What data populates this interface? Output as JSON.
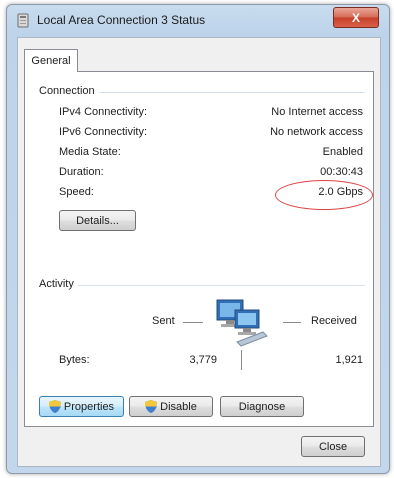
{
  "window": {
    "title": "Local Area Connection 3 Status",
    "close_glyph": "X"
  },
  "tabs": [
    {
      "label": "General"
    }
  ],
  "connection": {
    "heading": "Connection",
    "rows": [
      {
        "label": "IPv4 Connectivity:",
        "value": "No Internet access"
      },
      {
        "label": "IPv6 Connectivity:",
        "value": "No network access"
      },
      {
        "label": "Media State:",
        "value": "Enabled"
      },
      {
        "label": "Duration:",
        "value": "00:30:43"
      },
      {
        "label": "Speed:",
        "value": "2.0 Gbps"
      }
    ],
    "details_button": "Details..."
  },
  "activity": {
    "heading": "Activity",
    "sent_label": "Sent",
    "received_label": "Received",
    "bytes_label": "Bytes:",
    "bytes_sent": "3,779",
    "bytes_received": "1,921"
  },
  "buttons": {
    "properties": "Properties",
    "disable": "Disable",
    "diagnose": "Diagnose",
    "close": "Close"
  },
  "icons": {
    "title": "network-adapter-icon",
    "activity": "network-computers-icon",
    "shield": "uac-shield-icon"
  },
  "colors": {
    "titlebar": "#c3d7ec",
    "close_button": "#c7412a",
    "highlight_ellipse": "#dd4444"
  }
}
